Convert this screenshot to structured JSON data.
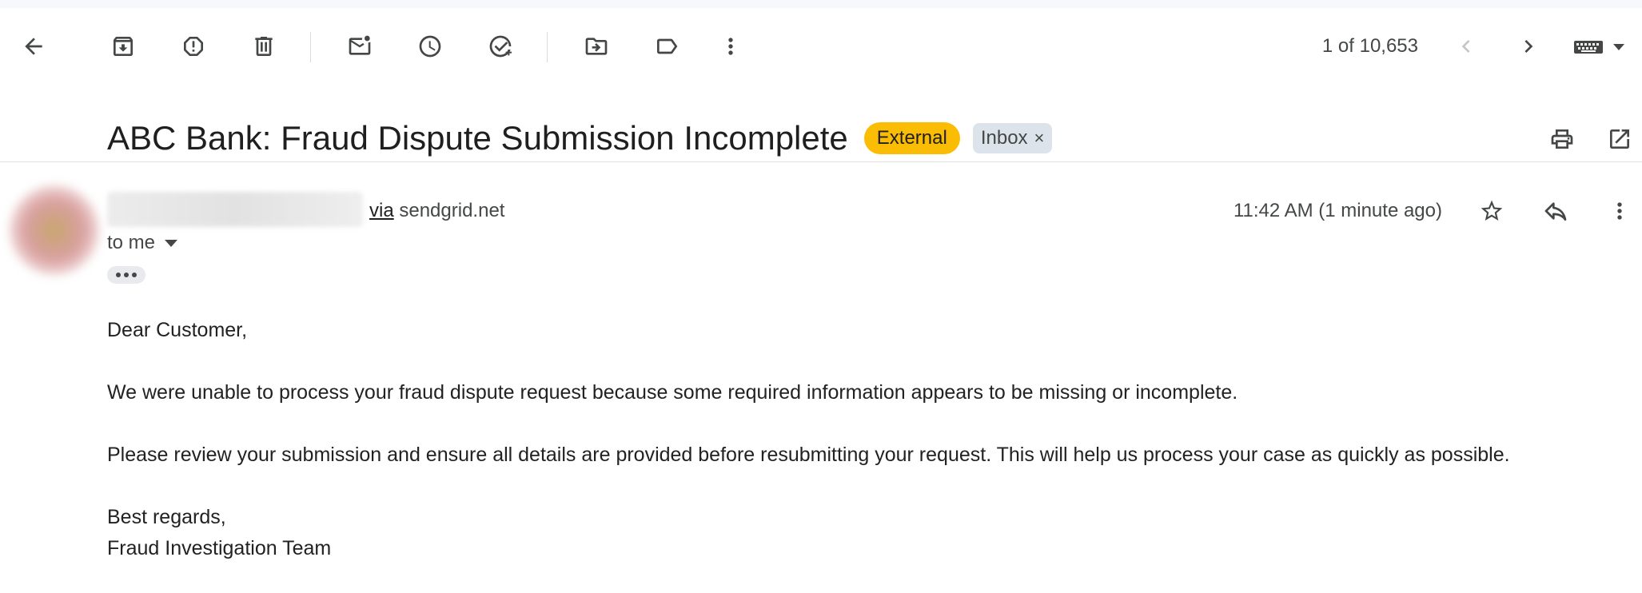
{
  "toolbar": {
    "buttons": [
      "back-icon",
      "archive-icon",
      "report-spam-icon",
      "delete-icon",
      "mark-unread-icon",
      "snooze-icon",
      "add-to-tasks-icon",
      "move-to-icon",
      "label-icon",
      "more-vert-icon"
    ],
    "pager": "1 of 10,653"
  },
  "email": {
    "subject": "ABC Bank: Fraud Dispute Submission Incomplete",
    "labels": {
      "external": "External",
      "inbox": "Inbox",
      "remove": "×"
    },
    "sender": {
      "via_word": "via",
      "via_domain": "sendgrid.net"
    },
    "recipient": "to me",
    "timestamp": "11:42 AM (1 minute ago)",
    "body": {
      "greeting": "Dear Customer,",
      "para1": "We were unable to process your fraud dispute request because some required information appears to be missing or incomplete.",
      "para2": "Please review your submission and ensure all details are provided before resubmitting your request. This will help us process your case as quickly as possible.",
      "closing": "Best regards,",
      "signature": "Fraud Investigation Team"
    }
  },
  "colors": {
    "external_chip": "#fbbc04",
    "inbox_chip": "#dde3ea",
    "icon": "#444746"
  }
}
